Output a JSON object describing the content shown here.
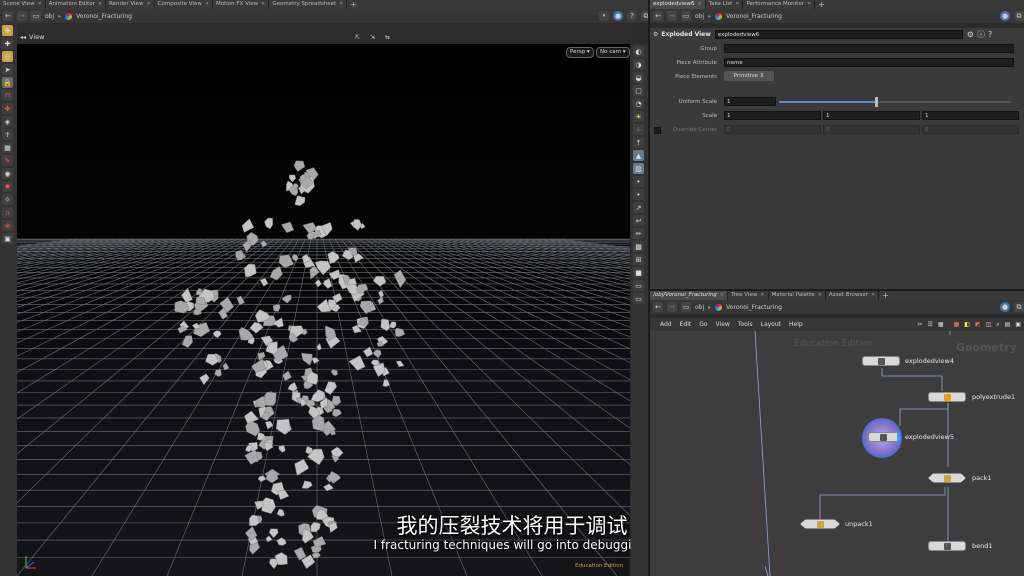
{
  "top_tabs": [
    "Scene View",
    "Animation Editor",
    "Render View",
    "Composite View",
    "Motion FX View",
    "Geometry Spreadsheet"
  ],
  "left_path": {
    "obj": "obj",
    "node": "Voronoi_Fracturing"
  },
  "viewport": {
    "label": "View",
    "persp": "Persp",
    "cam": "No cam",
    "watermark": "Education Edition",
    "subtitle_cn": "我的压裂技术将用于调试",
    "subtitle_en": "I fracturing techniques will go into debugging,"
  },
  "right_tabs": [
    "explodedview6",
    "Take List",
    "Performance Monitor"
  ],
  "param_path": {
    "obj": "obj",
    "node": "Voronoi_Fracturing"
  },
  "params": {
    "type_label": "Exploded View",
    "node_name": "explodedview6",
    "group_label": "Group",
    "group_value": "",
    "piece_attr_label": "Piece Attribute",
    "piece_attr_value": "name",
    "piece_elem_label": "Piece Elements",
    "piece_elem_value": "Primitive",
    "uniform_scale_label": "Uniform Scale",
    "uniform_scale_value": "1",
    "uniform_scale_fraction": 0.42,
    "scale_label": "Scale",
    "scale_values": [
      "1",
      "1",
      "1"
    ],
    "override_label": "Override Center",
    "override_values": [
      "0",
      "0",
      "0"
    ]
  },
  "net_tabs": [
    "/obj/Voronoi_Fracturing",
    "Tree View",
    "Material Palette",
    "Asset Browser"
  ],
  "net_path": {
    "obj": "obj",
    "node": "Voronoi_Fracturing"
  },
  "net_menu": [
    "Add",
    "Edit",
    "Go",
    "View",
    "Tools",
    "Layout",
    "Help"
  ],
  "network": {
    "watermark": "Education Edition",
    "context": "Geometry",
    "nodes": [
      "explodedview4",
      "polyextrude1",
      "explodedview5",
      "pack1",
      "unpack1",
      "bend1"
    ]
  }
}
